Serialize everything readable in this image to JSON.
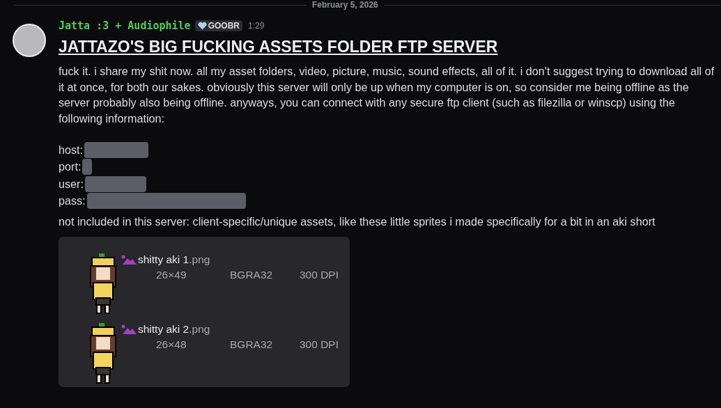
{
  "divider": {
    "date": "February 5, 2026"
  },
  "message": {
    "author": "Jatta :3 + Audiophile",
    "tag": "GOOBR",
    "time": "1:29",
    "heading": "JATTAZO'S BIG FUCKING ASSETS FOLDER FTP SERVER",
    "paragraph": "fuck it. i share my shit now. all my asset folders, video, picture, music, sound effects, all of it. i don't suggest trying to download all of it at once, for both our sakes. obviously this server will only be up when my computer is on, so consider me being offline as the server probably also being offline. anyways, you can connect with any secure ftp client (such as filezilla or winscp) using the following information:",
    "fields": [
      {
        "label": "host:",
        "spoiler": true
      },
      {
        "label": "port:",
        "spoiler": true
      },
      {
        "label": "user:",
        "spoiler": true
      },
      {
        "label": "pass:",
        "spoiler": true
      }
    ],
    "note": "not included in this server: client-specific/unique assets, like these little sprites i made specifically for a bit in an aki short",
    "files": [
      {
        "name": "shitty aki 1",
        "ext": ".png",
        "size": "26×49",
        "format": "BGRA32",
        "dpi": "300 DPI"
      },
      {
        "name": "shitty aki 2",
        "ext": ".png",
        "size": "26×48",
        "format": "BGRA32",
        "dpi": "300 DPI"
      }
    ]
  }
}
